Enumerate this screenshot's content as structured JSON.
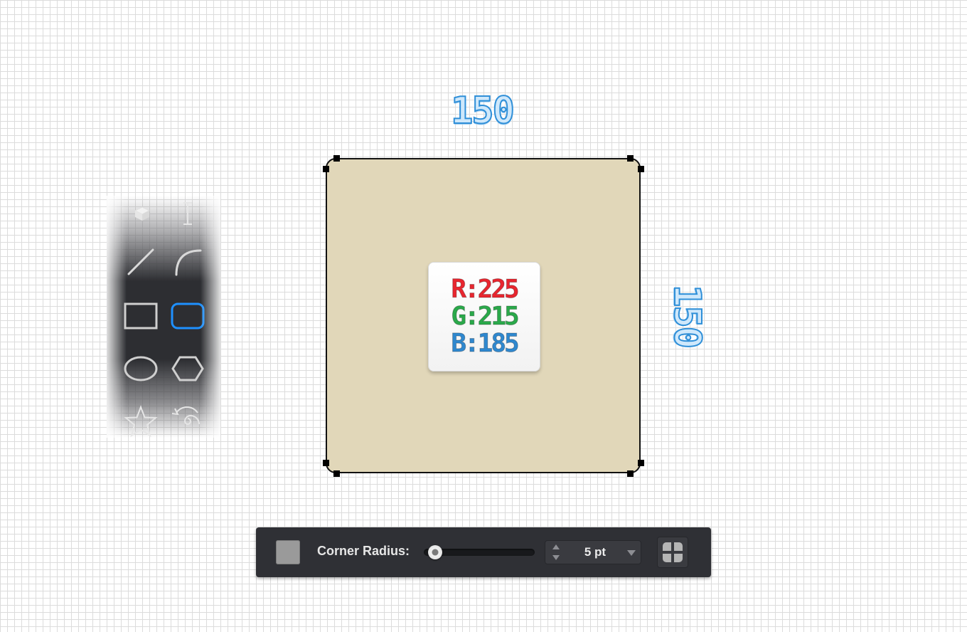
{
  "dimensions": {
    "width_label": "150",
    "height_label": "150"
  },
  "color_card": {
    "r": "R:225",
    "g": "G:215",
    "b": "B:185"
  },
  "shape_fill": "#e1d7b9",
  "tool_palette": {
    "tools": [
      "3d-box-icon",
      "text-tool-icon",
      "line-tool-icon",
      "arc-tool-icon",
      "rectangle-tool-icon",
      "rounded-rectangle-tool-icon",
      "ellipse-tool-icon",
      "polygon-tool-icon",
      "star-tool-icon",
      "spiral-tool-icon"
    ],
    "selected": "rounded-rectangle-tool-icon",
    "accent": "#1e90ff"
  },
  "toolbar": {
    "corner_radius_label": "Corner Radius:",
    "corner_radius_value": "5 pt",
    "slider_fraction": 0.1,
    "swatch_color": "#9a9a9a"
  }
}
